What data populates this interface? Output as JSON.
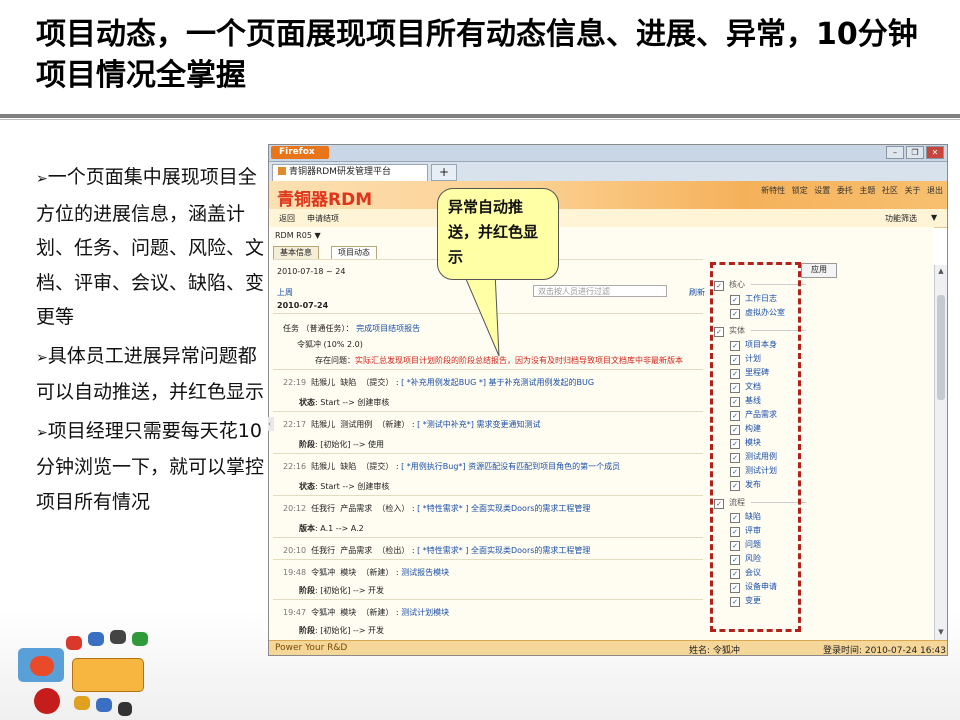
{
  "slide": {
    "title": "项目动态，一个页面展现项目所有动态信息、进展、异常，10分钟项目情况全掌握",
    "bullets": [
      "一个页面集中展现项目全方位的进展信息，涵盖计划、任务、问题、风险、文档、评审、会议、缺陷、变更等",
      "具体员工进展异常问题都可以自动推送，并红色显示",
      "项目经理只需要每天花10分钟浏览一下，就可以掌控项目所有情况"
    ],
    "bullet_mark": "➢",
    "callout": "异常自动推送，并红色显示"
  },
  "browser": {
    "firefox_button": "Firefox",
    "window_buttons": [
      "–",
      "❐",
      "✕"
    ],
    "tab_title": "青铜器RDM研发管理平台",
    "new_tab": "+"
  },
  "app": {
    "brand": "青铜器RDM",
    "top_links": [
      "新特性",
      "锁定",
      "设置",
      "委托",
      "主题",
      "社区",
      "关于",
      "退出"
    ],
    "nav": {
      "back": "返回",
      "apply_link": "申请结项",
      "function_filter": "功能筛选",
      "dropdown_arrow": "▼"
    },
    "project_selector": "RDM R05",
    "tabs": [
      "基本信息",
      "项目动态"
    ],
    "date_range": "2010-07-18 ~ 24",
    "prev_week": "上周",
    "filter_placeholder": "双击按人员进行过滤",
    "refresh": "刷新",
    "apply_button": "应用",
    "day_label": "2010-07-24",
    "task": {
      "type": "任务",
      "kind": "（普通任务）",
      "sep": "：",
      "title": "完成项目结项报告",
      "assignee_progress": "令狐冲 (10% 2.0)",
      "issue_label": "存在问题：",
      "issue_text": "实际汇总发现项目计划阶段的阶段总结报告，因为没有及时归档导致项目文档库中非最新版本"
    },
    "events": [
      {
        "time": "22:19",
        "who": "陆猴儿",
        "kind": "缺陷",
        "action": "（提交）",
        "title": "[ *补充用例发起BUG *] 基于补充测试用例发起的BUG",
        "detail_label": "状态",
        "detail_text": ": Start --> 创建审核"
      },
      {
        "time": "22:17",
        "who": "陆猴儿",
        "kind": "测试用例",
        "action": "（新建）",
        "title": "[ *测试中补充*] 需求变更通知测试",
        "detail_label": "阶段",
        "detail_text": ": [初始化] --> 使用"
      },
      {
        "time": "22:16",
        "who": "陆猴儿",
        "kind": "缺陷",
        "action": "（提交）",
        "title": "[ *用例执行Bug*] 资源匹配没有匹配到项目角色的第一个成员",
        "detail_label": "状态",
        "detail_text": ": Start --> 创建审核"
      },
      {
        "time": "20:12",
        "who": "任我行",
        "kind": "产品需求",
        "action": "（检入）",
        "title": "[ *特性需求* ] 全面实现类Doors的需求工程管理",
        "detail_label": "版本",
        "detail_text": ": A.1 --> A.2"
      },
      {
        "time": "20:10",
        "who": "任我行",
        "kind": "产品需求",
        "action": "（检出）",
        "title": "[ *特性需求* ] 全面实现类Doors的需求工程管理",
        "detail_label": "",
        "detail_text": ""
      },
      {
        "time": "19:48",
        "who": "令狐冲",
        "kind": "模块",
        "action": "（新建）",
        "title": "测试报告模块",
        "detail_label": "阶段",
        "detail_text": ": [初始化] --> 开发"
      },
      {
        "time": "19:47",
        "who": "令狐冲",
        "kind": "模块",
        "action": "（新建）",
        "title": "测试计划模块",
        "detail_label": "阶段",
        "detail_text": ": [初始化] --> 开发"
      }
    ],
    "right_panel": [
      {
        "group": "核心",
        "items": [
          "工作日志",
          "虚拟办公室"
        ]
      },
      {
        "group": "实体",
        "items": [
          "项目本身",
          "计划",
          "里程碑",
          "文档",
          "基线",
          "产品需求",
          "构建",
          "模块",
          "测试用例",
          "测试计划",
          "发布"
        ]
      },
      {
        "group": "流程",
        "items": [
          "缺陷",
          "评审",
          "问题",
          "风险",
          "会议",
          "设备申请",
          "变更"
        ]
      }
    ],
    "checkmark": "✓",
    "status_left": "Power Your R&D",
    "status_user": "姓名: 令狐冲",
    "status_login": "登录时间: 2010-07-24 16:43"
  },
  "colors": {
    "accent_red": "#d0221a",
    "link_blue": "#1b4fa8",
    "brand_red": "#e0351a",
    "banner_orange": "#f5b15a",
    "callout_yellow": "#ffffa6"
  }
}
